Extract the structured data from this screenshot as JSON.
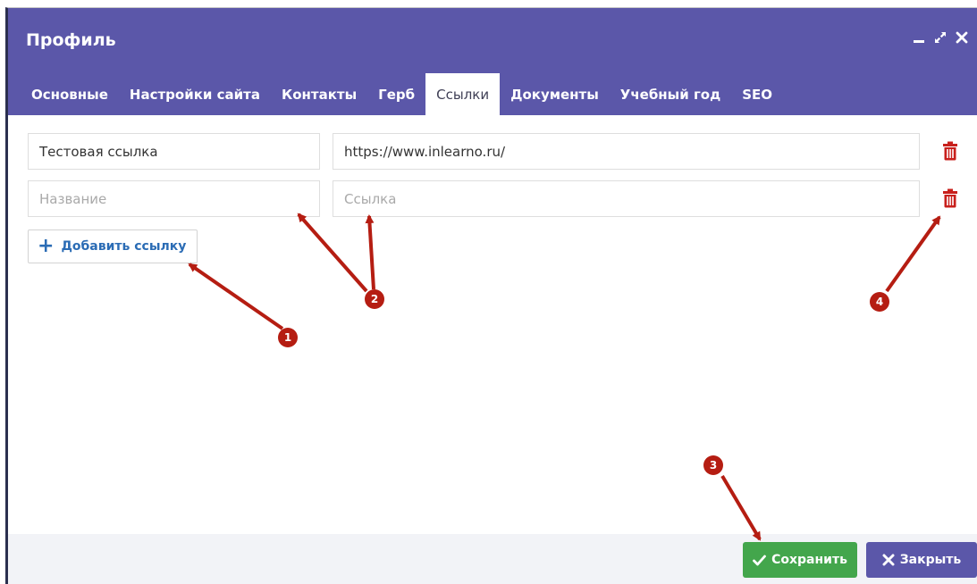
{
  "window": {
    "title": "Профиль",
    "controls": [
      "minimize-icon",
      "maximize-icon",
      "close-icon"
    ]
  },
  "tabs": [
    {
      "label": "Основные"
    },
    {
      "label": "Настройки сайта"
    },
    {
      "label": "Контакты"
    },
    {
      "label": "Герб"
    },
    {
      "label": "Ссылки",
      "active": true
    },
    {
      "label": "Документы"
    },
    {
      "label": "Учебный год"
    },
    {
      "label": "SEO"
    }
  ],
  "links": [
    {
      "name_value": "Тестовая ссылка",
      "url_value": "https://www.inlearno.ru/",
      "name_placeholder": "Название",
      "url_placeholder": "Ссылка"
    },
    {
      "name_value": "",
      "url_value": "",
      "name_placeholder": "Название",
      "url_placeholder": "Ссылка"
    }
  ],
  "add_link_label": "Добавить ссылку",
  "footer": {
    "save_label": "Сохранить",
    "close_label": "Закрыть"
  },
  "annotations": [
    "1",
    "2",
    "3",
    "4"
  ],
  "colors": {
    "header": "#5b57a9",
    "save": "#43a64c",
    "close": "#5b57a9",
    "trash": "#c8201c",
    "annotation": "#b51d12",
    "link_accent": "#2b6cb5"
  }
}
